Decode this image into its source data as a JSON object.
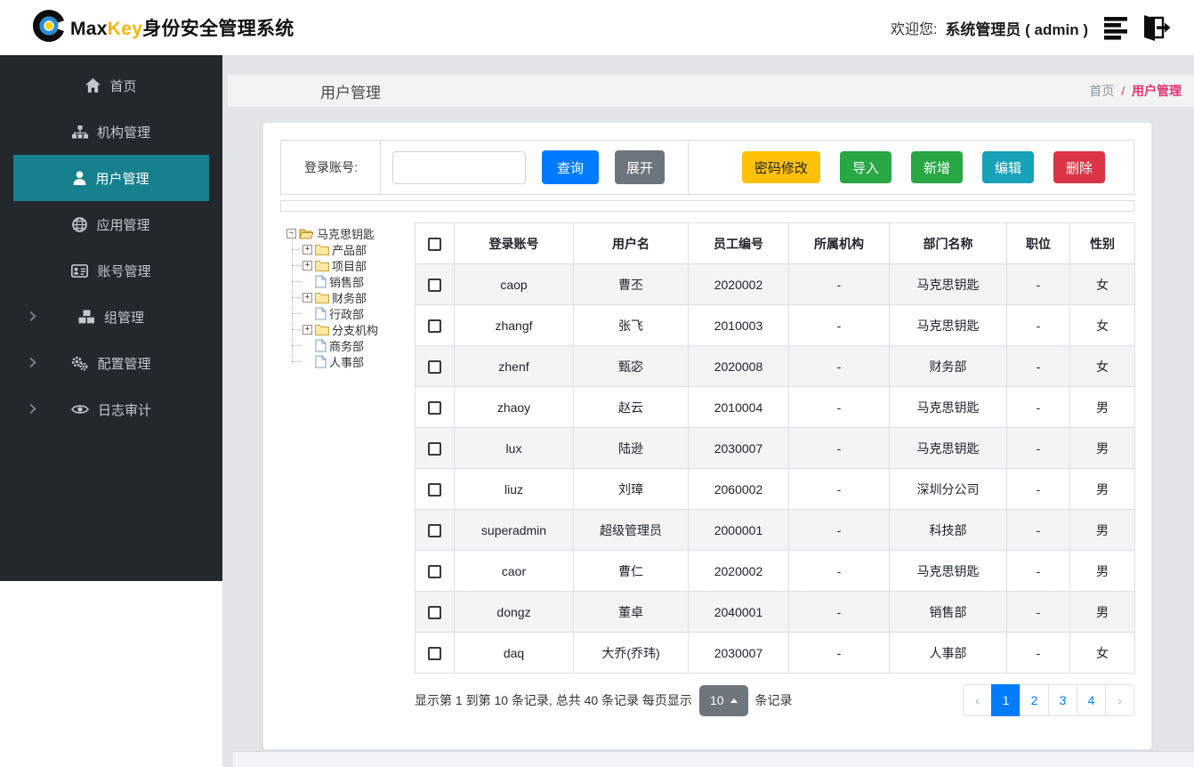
{
  "header": {
    "brand_max": "Max",
    "brand_key": "Key",
    "brand_suffix": "身份安全管理系统",
    "welcome_label": "欢迎您:",
    "user": "系统管理员 ( admin )"
  },
  "sidebar": {
    "active_color": "#17808e",
    "items": [
      {
        "label": "首页",
        "icon": "home-icon",
        "active": false,
        "has_submenu": false
      },
      {
        "label": "机构管理",
        "icon": "sitemap-icon",
        "active": false,
        "has_submenu": false
      },
      {
        "label": "用户管理",
        "icon": "user-icon",
        "active": true,
        "has_submenu": false
      },
      {
        "label": "应用管理",
        "icon": "globe-icon",
        "active": false,
        "has_submenu": false
      },
      {
        "label": "账号管理",
        "icon": "id-card-icon",
        "active": false,
        "has_submenu": false
      },
      {
        "label": "组管理",
        "icon": "cubes-icon",
        "active": false,
        "has_submenu": true
      },
      {
        "label": "配置管理",
        "icon": "gears-icon",
        "active": false,
        "has_submenu": true
      },
      {
        "label": "日志审计",
        "icon": "eye-icon",
        "active": false,
        "has_submenu": true
      }
    ]
  },
  "page": {
    "title": "用户管理",
    "breadcrumb": {
      "root": "首页",
      "separator": "/",
      "current": "用户管理",
      "current_color": "#e7326e"
    }
  },
  "toolbar": {
    "search_label": "登录账号:",
    "search_value": "",
    "query_button": "查询",
    "expand_button": "展开",
    "action_buttons": [
      {
        "name": "password-change-button",
        "label": "密码修改",
        "bg": "#ffc107",
        "text_color": "#212529"
      },
      {
        "name": "import-button",
        "label": "导入",
        "bg": "#28a745",
        "text_color": "#ffffff"
      },
      {
        "name": "add-button",
        "label": "新增",
        "bg": "#28a745",
        "text_color": "#ffffff"
      },
      {
        "name": "edit-button",
        "label": "编辑",
        "bg": "#17a2b8",
        "text_color": "#ffffff"
      },
      {
        "name": "delete-button",
        "label": "删除",
        "bg": "#dc3545",
        "text_color": "#ffffff"
      }
    ]
  },
  "tree": {
    "nodes": [
      {
        "label": "马克思钥匙",
        "level": 0,
        "expander": "minus",
        "icon": "folder-open-icon"
      },
      {
        "label": "产品部",
        "level": 1,
        "expander": "plus",
        "icon": "folder-icon"
      },
      {
        "label": "项目部",
        "level": 1,
        "expander": "plus",
        "icon": "folder-icon"
      },
      {
        "label": "销售部",
        "level": 1,
        "expander": "none",
        "icon": "file-icon"
      },
      {
        "label": "财务部",
        "level": 1,
        "expander": "plus",
        "icon": "folder-icon"
      },
      {
        "label": "行政部",
        "level": 1,
        "expander": "none",
        "icon": "file-icon"
      },
      {
        "label": "分支机构",
        "level": 1,
        "expander": "plus",
        "icon": "folder-icon"
      },
      {
        "label": "商务部",
        "level": 1,
        "expander": "none",
        "icon": "file-icon"
      },
      {
        "label": "人事部",
        "level": 1,
        "expander": "none",
        "icon": "file-icon"
      }
    ]
  },
  "table": {
    "columns": [
      "登录账号",
      "用户名",
      "员工编号",
      "所属机构",
      "部门名称",
      "职位",
      "性别"
    ],
    "rows": [
      [
        "caop",
        "曹丕",
        "2020002",
        "-",
        "马克思钥匙",
        "-",
        "女"
      ],
      [
        "zhangf",
        "张飞",
        "2010003",
        "-",
        "马克思钥匙",
        "-",
        "女"
      ],
      [
        "zhenf",
        "甄宓",
        "2020008",
        "-",
        "财务部",
        "-",
        "女"
      ],
      [
        "zhaoy",
        "赵云",
        "2010004",
        "-",
        "马克思钥匙",
        "-",
        "男"
      ],
      [
        "lux",
        "陆逊",
        "2030007",
        "-",
        "马克思钥匙",
        "-",
        "男"
      ],
      [
        "liuz",
        "刘璋",
        "2060002",
        "-",
        "深圳分公司",
        "-",
        "男"
      ],
      [
        "superadmin",
        "超级管理员",
        "2000001",
        "-",
        "科技部",
        "-",
        "男"
      ],
      [
        "caor",
        "曹仁",
        "2020002",
        "-",
        "马克思钥匙",
        "-",
        "男"
      ],
      [
        "dongz",
        "董卓",
        "2040001",
        "-",
        "销售部",
        "-",
        "男"
      ],
      [
        "daq",
        "大乔(乔玮)",
        "2030007",
        "-",
        "人事部",
        "-",
        "女"
      ]
    ]
  },
  "pagination": {
    "summary_prefix": "显示第 1 到第 10 条记录, 总共 40 条记录 每页显示",
    "page_size": "10",
    "summary_suffix": "条记录",
    "prev_label": "‹",
    "next_label": "›",
    "pages": [
      "1",
      "2",
      "3",
      "4"
    ],
    "active_page": "1",
    "active_color": "#007bff"
  }
}
